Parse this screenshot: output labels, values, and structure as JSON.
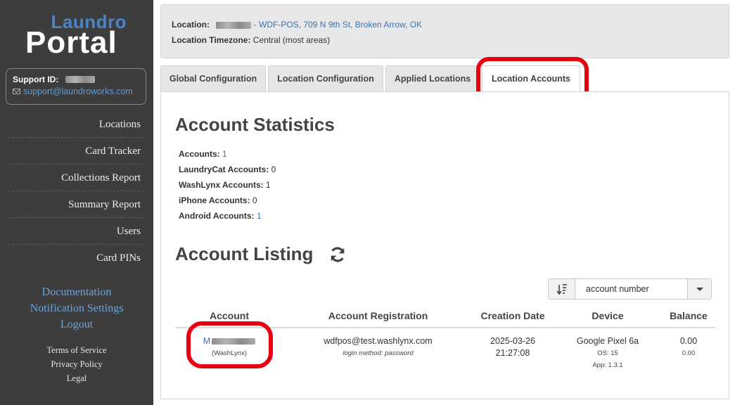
{
  "app": {
    "logo_top": "Laundro",
    "logo_bottom": "Portal"
  },
  "support": {
    "id_label": "Support ID:",
    "email": "support@laundroworks.com"
  },
  "nav": {
    "items": [
      {
        "label": "Locations"
      },
      {
        "label": "Card Tracker"
      },
      {
        "label": "Collections Report"
      },
      {
        "label": "Summary Report"
      },
      {
        "label": "Users"
      },
      {
        "label": "Card PINs"
      }
    ]
  },
  "side_links": {
    "documentation": "Documentation",
    "notification_settings": "Notification Settings",
    "logout": "Logout"
  },
  "legal": {
    "terms": "Terms of Service",
    "privacy": "Privacy Policy",
    "legal": "Legal"
  },
  "location": {
    "label": "Location:",
    "value_suffix": " - WDF-POS, 709 N 9th St, Broken Arrow, OK",
    "timezone_label": "Location Timezone:",
    "timezone_value": "Central (most areas)"
  },
  "tabs": [
    {
      "label": "Global Configuration"
    },
    {
      "label": "Location Configuration"
    },
    {
      "label": "Applied Locations"
    },
    {
      "label": "Location Accounts"
    }
  ],
  "stats": {
    "heading": "Account Statistics",
    "accounts_label": "Accounts:",
    "accounts_value": "1",
    "laundrycat_label": "LaundryCat Accounts:",
    "laundrycat_value": "0",
    "washlynx_label": "WashLynx Accounts:",
    "washlynx_value": "1",
    "iphone_label": "iPhone Accounts:",
    "iphone_value": "0",
    "android_label": "Android Accounts:",
    "android_value": "1"
  },
  "listing": {
    "heading": "Account Listing",
    "sort_value": "account number",
    "columns": [
      "Account",
      "Account Registration",
      "Creation Date",
      "Device",
      "Balance"
    ],
    "rows": [
      {
        "account_prefix": "M",
        "account_type": "(WashLynx)",
        "registration_email": "wdfpos@test.washlynx.com",
        "login_method": "login method: password",
        "creation_date": "2025-03-26",
        "creation_time": "21:27:08",
        "device": "Google Pixel 6a",
        "os": "OS: 15",
        "app": "App: 1.3.1",
        "balance": "0.00",
        "balance_sub": "0.00"
      }
    ]
  },
  "colors": {
    "sidebar": "#3d3d3d",
    "link": "#3b73b0",
    "highlight": "#e8000e"
  }
}
